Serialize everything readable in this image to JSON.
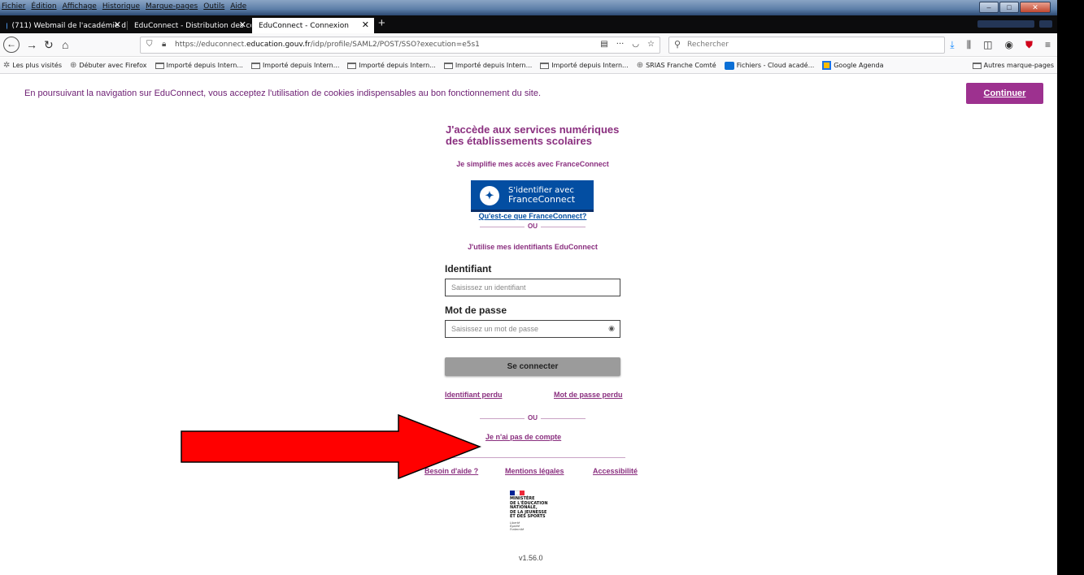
{
  "menu": [
    "Fichier",
    "Édition",
    "Affichage",
    "Historique",
    "Marque-pages",
    "Outils",
    "Aide"
  ],
  "tabs": [
    {
      "label": "(711) Webmail de l'académie d",
      "active": false
    },
    {
      "label": "EduConnect - Distribution des com",
      "active": false
    },
    {
      "label": "EduConnect - Connexion",
      "active": true
    }
  ],
  "nav": {
    "url_prefix": "https://educonnect.",
    "url_domain": "education.gouv.fr",
    "url_suffix": "/idp/profile/SAML2/POST/SSO?execution=e5s1",
    "search_placeholder": "Rechercher"
  },
  "bookmarks": [
    {
      "label": "Les plus visités",
      "icon": "gear-icon"
    },
    {
      "label": "Débuter avec Firefox",
      "icon": "globe-icon"
    },
    {
      "label": "Importé depuis Intern...",
      "icon": "folder-icon"
    },
    {
      "label": "Importé depuis Intern...",
      "icon": "folder-icon"
    },
    {
      "label": "Importé depuis Intern...",
      "icon": "folder-icon"
    },
    {
      "label": "Importé depuis Intern...",
      "icon": "folder-icon"
    },
    {
      "label": "Importé depuis Intern...",
      "icon": "folder-icon"
    },
    {
      "label": "SRIAS Franche Comté",
      "icon": "globe-icon"
    },
    {
      "label": "Fichiers - Cloud acadé...",
      "icon": "cloud-icon"
    },
    {
      "label": "Google Agenda",
      "icon": "calendar-icon"
    }
  ],
  "bookmarks_other": "Autres marque-pages",
  "page": {
    "cookie_notice": "En poursuivant la navigation sur EduConnect, vous acceptez l'utilisation de cookies indispensables au bon fonctionnement du site.",
    "continue_label": "Continuer",
    "title_line1": "J'accède aux services numériques",
    "title_line2": "des établissements scolaires",
    "fc_intro": "Je simplifie mes accès avec FranceConnect",
    "fc_button_line1": "S'identifier avec",
    "fc_button_line2": "FranceConnect",
    "fc_what": "Qu'est-ce que FranceConnect?",
    "or_label": "OU",
    "edu_intro": "J'utilise mes identifiants EduConnect",
    "id_label": "Identifiant",
    "id_placeholder": "Saisissez un identifiant",
    "pw_label": "Mot de passe",
    "pw_placeholder": "Saisissez un mot de passe",
    "submit_label": "Se connecter",
    "lost_id": "Identifiant perdu",
    "lost_pw": "Mot de passe perdu",
    "no_account": "Je n'ai pas de compte",
    "help": "Besoin d'aide ?",
    "legal": "Mentions légales",
    "accessibility": "Accessibilité",
    "ministry_line1": "MINISTÈRE",
    "ministry_line2": "DE L'ÉDUCATION",
    "ministry_line3": "NATIONALE,",
    "ministry_line4": "DE LA JEUNESSE",
    "ministry_line5": "ET DES SPORTS",
    "motto1": "Liberté",
    "motto2": "Égalité",
    "motto3": "Fraternité",
    "version": "v1.56.0"
  },
  "colors": {
    "accent": "#9d318f",
    "link": "#8a2f7f",
    "franceconnect": "#034ea2",
    "annotation_arrow": "#ff0000"
  }
}
